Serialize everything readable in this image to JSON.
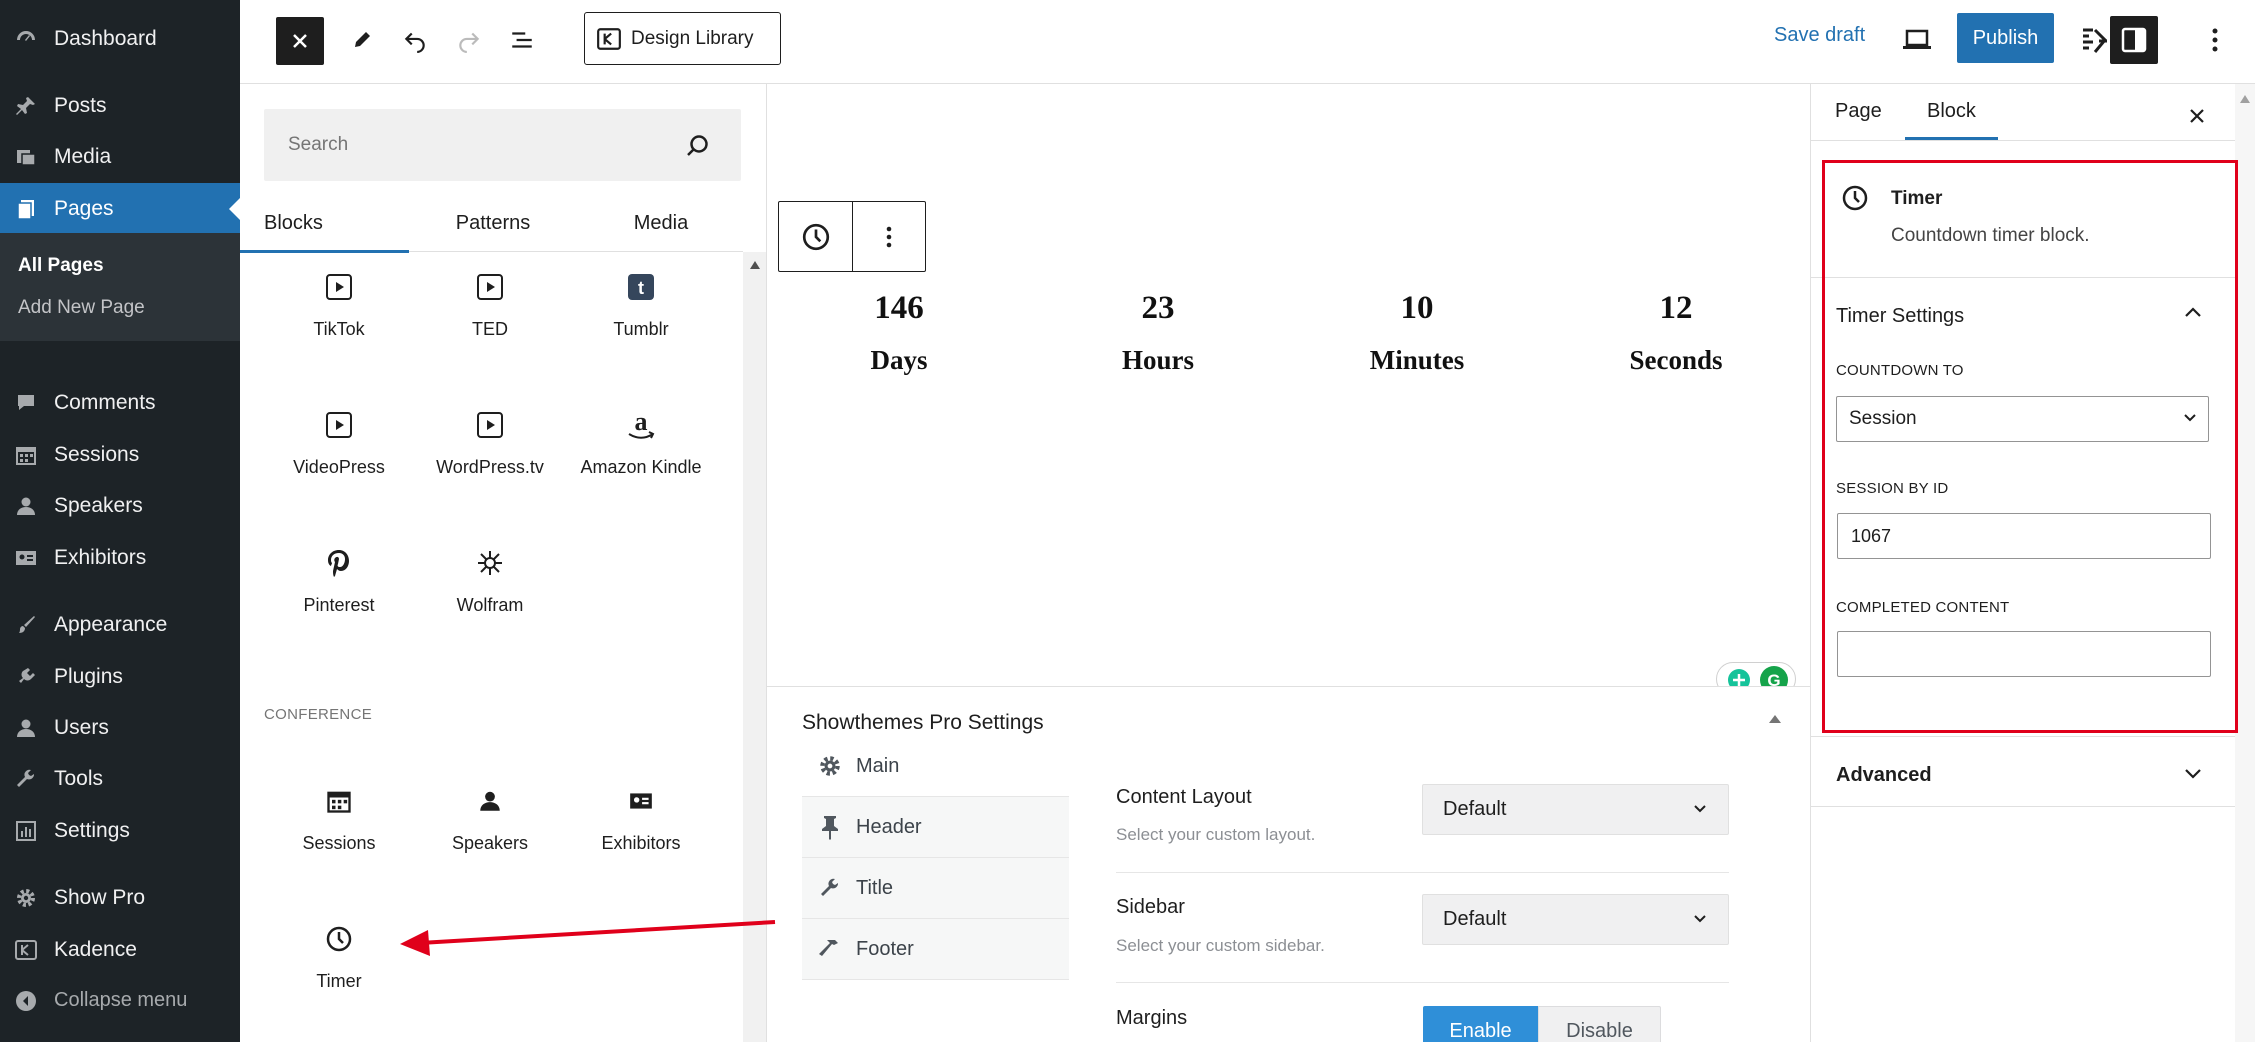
{
  "admin_menu": {
    "items": [
      {
        "label": "Dashboard",
        "icon": "dashboard-icon"
      },
      {
        "label": "Posts",
        "icon": "pin-icon"
      },
      {
        "label": "Media",
        "icon": "media-icon"
      },
      {
        "label": "Pages",
        "icon": "pages-icon"
      },
      {
        "label": "Comments",
        "icon": "comments-icon"
      },
      {
        "label": "Sessions",
        "icon": "calendar-icon"
      },
      {
        "label": "Speakers",
        "icon": "person-icon"
      },
      {
        "label": "Exhibitors",
        "icon": "id-card-icon"
      },
      {
        "label": "Appearance",
        "icon": "brush-icon"
      },
      {
        "label": "Plugins",
        "icon": "plug-icon"
      },
      {
        "label": "Users",
        "icon": "users-icon"
      },
      {
        "label": "Tools",
        "icon": "wrench-icon"
      },
      {
        "label": "Settings",
        "icon": "settings-icon"
      },
      {
        "label": "Show Pro",
        "icon": "gear-icon"
      },
      {
        "label": "Kadence",
        "icon": "kadence-icon"
      },
      {
        "label": "Collapse menu",
        "icon": "collapse-icon"
      }
    ],
    "submenu": [
      "All Pages",
      "Add New Page"
    ],
    "current": "Pages"
  },
  "toolbar": {
    "design_library": "Design Library",
    "save_draft": "Save draft",
    "publish": "Publish"
  },
  "inserter": {
    "search_placeholder": "Search",
    "tabs": [
      "Blocks",
      "Patterns",
      "Media"
    ],
    "active_tab": "Blocks",
    "embed_blocks": [
      "TikTok",
      "TED",
      "Tumblr",
      "VideoPress",
      "WordPress.tv",
      "Amazon Kindle",
      "Pinterest",
      "Wolfram"
    ],
    "category": "CONFERENCE",
    "conference_blocks": [
      "Sessions",
      "Speakers",
      "Exhibitors",
      "Timer"
    ]
  },
  "timer": {
    "days": "146",
    "days_label": "Days",
    "hours": "23",
    "hours_label": "Hours",
    "minutes": "10",
    "minutes_label": "Minutes",
    "seconds": "12",
    "seconds_label": "Seconds"
  },
  "metabox": {
    "title": "Showthemes Pro Settings",
    "nav": [
      "Main",
      "Header",
      "Title",
      "Footer"
    ],
    "fields": [
      {
        "label": "Content Layout",
        "desc": "Select your custom layout.",
        "value": "Default"
      },
      {
        "label": "Sidebar",
        "desc": "Select your custom sidebar.",
        "value": "Default"
      },
      {
        "label": "Margins"
      }
    ],
    "enable": "Enable",
    "disable": "Disable"
  },
  "settings_panel": {
    "tabs": [
      "Page",
      "Block"
    ],
    "active_tab": "Block",
    "block_title": "Timer",
    "block_desc": "Countdown timer block.",
    "section_title": "Timer Settings",
    "countdown_label": "COUNTDOWN TO",
    "countdown_value": "Session",
    "session_label": "SESSION BY ID",
    "session_value": "1067",
    "completed_label": "COMPLETED CONTENT",
    "completed_value": "",
    "advanced": "Advanced"
  },
  "colors": {
    "admin_bg": "#1d2327",
    "accent": "#2271b1",
    "highlight": "#e0001b"
  }
}
